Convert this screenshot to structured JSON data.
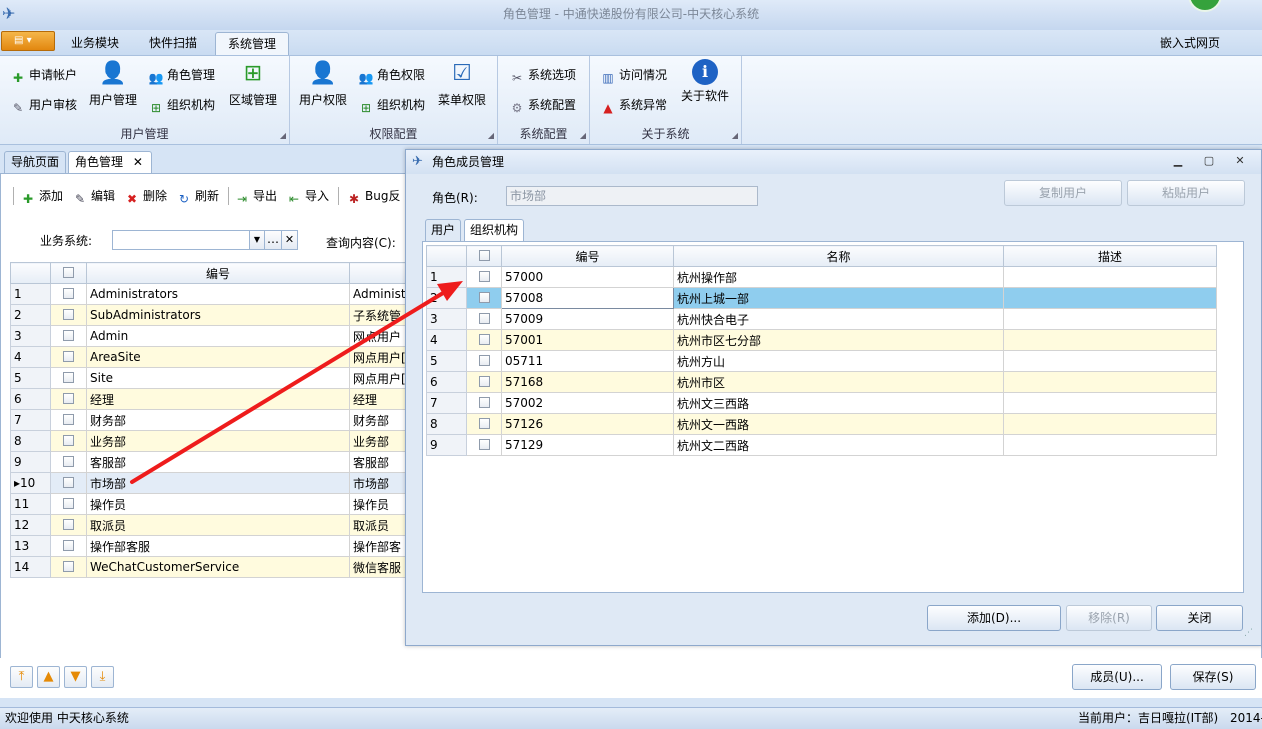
{
  "window": {
    "title": "角色管理 - 中通快递股份有限公司-中天核心系统"
  },
  "ribbon_tabs": [
    "业务模块",
    "快件扫描",
    "系统管理"
  ],
  "embed_label": "嵌入式网页",
  "ribbon": {
    "user_mgmt": {
      "label": "用户管理",
      "apply_account": "申请帐户",
      "user_audit": "用户审核",
      "user_manage": "用户管理",
      "role_manage": "角色管理",
      "org": "组织机构",
      "region": "区域管理"
    },
    "perm": {
      "label": "权限配置",
      "user_perm": "用户权限",
      "role_perm": "角色权限",
      "org": "组织机构",
      "menu_perm": "菜单权限"
    },
    "sysconf": {
      "label": "系统配置",
      "options": "系统选项",
      "config": "系统配置"
    },
    "about": {
      "label": "关于系统",
      "visits": "访问情况",
      "errors": "系统异常",
      "about_soft": "关于软件"
    }
  },
  "doc_tabs": {
    "nav": "导航页面",
    "role": "角色管理",
    "close": "✕"
  },
  "toolbar": {
    "add": "添加",
    "edit": "编辑",
    "delete": "删除",
    "refresh": "刷新",
    "export": "导出",
    "import": "导入",
    "bug": "Bug反"
  },
  "filter": {
    "business_label": "业务系统:",
    "query_label": "查询内容(C):"
  },
  "left_grid": {
    "header_code": "编号",
    "rows": [
      {
        "n": "1",
        "code": "Administrators",
        "name": "Administr"
      },
      {
        "n": "2",
        "code": "SubAdministrators",
        "name": "子系统管"
      },
      {
        "n": "3",
        "code": "Admin",
        "name": "网点用户"
      },
      {
        "n": "4",
        "code": "AreaSite",
        "name": "网点用户["
      },
      {
        "n": "5",
        "code": "Site",
        "name": "网点用户["
      },
      {
        "n": "6",
        "code": "经理",
        "name": "经理"
      },
      {
        "n": "7",
        "code": "财务部",
        "name": "财务部"
      },
      {
        "n": "8",
        "code": "业务部",
        "name": "业务部"
      },
      {
        "n": "9",
        "code": "客服部",
        "name": "客服部"
      },
      {
        "n": "10",
        "code": "市场部",
        "name": "市场部"
      },
      {
        "n": "11",
        "code": "操作员",
        "name": "操作员"
      },
      {
        "n": "12",
        "code": "取派员",
        "name": "取派员"
      },
      {
        "n": "13",
        "code": "操作部客服",
        "name": "操作部客"
      },
      {
        "n": "14",
        "code": "WeChatCustomerService",
        "name": "微信客服"
      }
    ]
  },
  "bottom": {
    "members_btn": "成员(U)...",
    "save_btn": "保存(S)"
  },
  "status": {
    "welcome": "欢迎使用 中天核心系统",
    "user": "当前用户：吉日嘎拉(IT部)",
    "date": "2014-"
  },
  "dialog": {
    "title": "角色成员管理",
    "role_label": "角色(R):",
    "role_value": "市场部",
    "copy_btn": "复制用户",
    "paste_btn": "粘贴用户",
    "tab_user": "用户",
    "tab_org": "组织机构",
    "headers": {
      "code": "编号",
      "name": "名称",
      "desc": "描述"
    },
    "rows": [
      {
        "n": "1",
        "code": "57000",
        "name": "杭州操作部"
      },
      {
        "n": "2",
        "code": "57008",
        "name": "杭州上城一部"
      },
      {
        "n": "3",
        "code": "57009",
        "name": "杭州快合电子"
      },
      {
        "n": "4",
        "code": "57001",
        "name": "杭州市区七分部"
      },
      {
        "n": "5",
        "code": "05711",
        "name": "杭州方山"
      },
      {
        "n": "6",
        "code": "57168",
        "name": "杭州市区"
      },
      {
        "n": "7",
        "code": "57002",
        "name": "杭州文三西路"
      },
      {
        "n": "8",
        "code": "57126",
        "name": "杭州文一西路"
      },
      {
        "n": "9",
        "code": "57129",
        "name": "杭州文二西路"
      }
    ],
    "add_btn": "添加(D)...",
    "remove_btn": "移除(R)",
    "close_btn": "关闭"
  },
  "colors": {
    "accent": "#e2870f",
    "selected_row": "#8fcdee",
    "alt_row": "#fffbde",
    "arrow": "#ee1c1c"
  }
}
